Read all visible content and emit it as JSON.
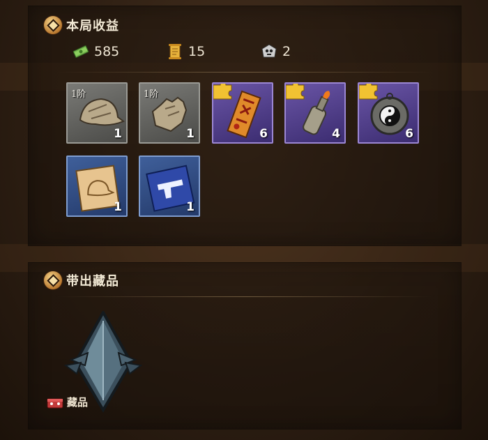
{
  "earnings": {
    "title": "本局收益",
    "resources": [
      {
        "icon": "cash-stack-icon",
        "value": "585"
      },
      {
        "icon": "gold-scroll-icon",
        "value": "15"
      },
      {
        "icon": "skull-token-icon",
        "value": "2"
      }
    ],
    "items": [
      {
        "name": "cap",
        "icon": "cap-icon",
        "tier": "1阶",
        "qty": "1",
        "rarity": "gray",
        "puzzle": false
      },
      {
        "name": "gloves",
        "icon": "glove-icon",
        "tier": "1阶",
        "qty": "1",
        "rarity": "gray",
        "puzzle": false
      },
      {
        "name": "talisman",
        "icon": "talisman-scroll-icon",
        "tier": "",
        "qty": "6",
        "rarity": "purple",
        "puzzle": true
      },
      {
        "name": "molotov",
        "icon": "molotov-bottle-icon",
        "tier": "",
        "qty": "4",
        "rarity": "purple",
        "puzzle": true
      },
      {
        "name": "taiji-amulet",
        "icon": "yin-yang-amulet-icon",
        "tier": "",
        "qty": "6",
        "rarity": "purple",
        "puzzle": true
      },
      {
        "name": "cap-blueprint",
        "icon": "cap-blueprint-icon",
        "tier": "",
        "qty": "1",
        "rarity": "blue",
        "puzzle": false
      },
      {
        "name": "pistol-blueprint",
        "icon": "pistol-blueprint-icon",
        "tier": "",
        "qty": "1",
        "rarity": "blue",
        "puzzle": false
      }
    ]
  },
  "collectibles": {
    "title": "带出藏品",
    "relic_icon": "spiked-crest-emblem-icon",
    "relic_label": "藏品",
    "relic_label_icon": "red-chest-icon"
  },
  "colors": {
    "gray": "#7a7a76",
    "purple": "#5b48a0",
    "blue": "#34528a",
    "accent_gold": "#e3a94a"
  }
}
